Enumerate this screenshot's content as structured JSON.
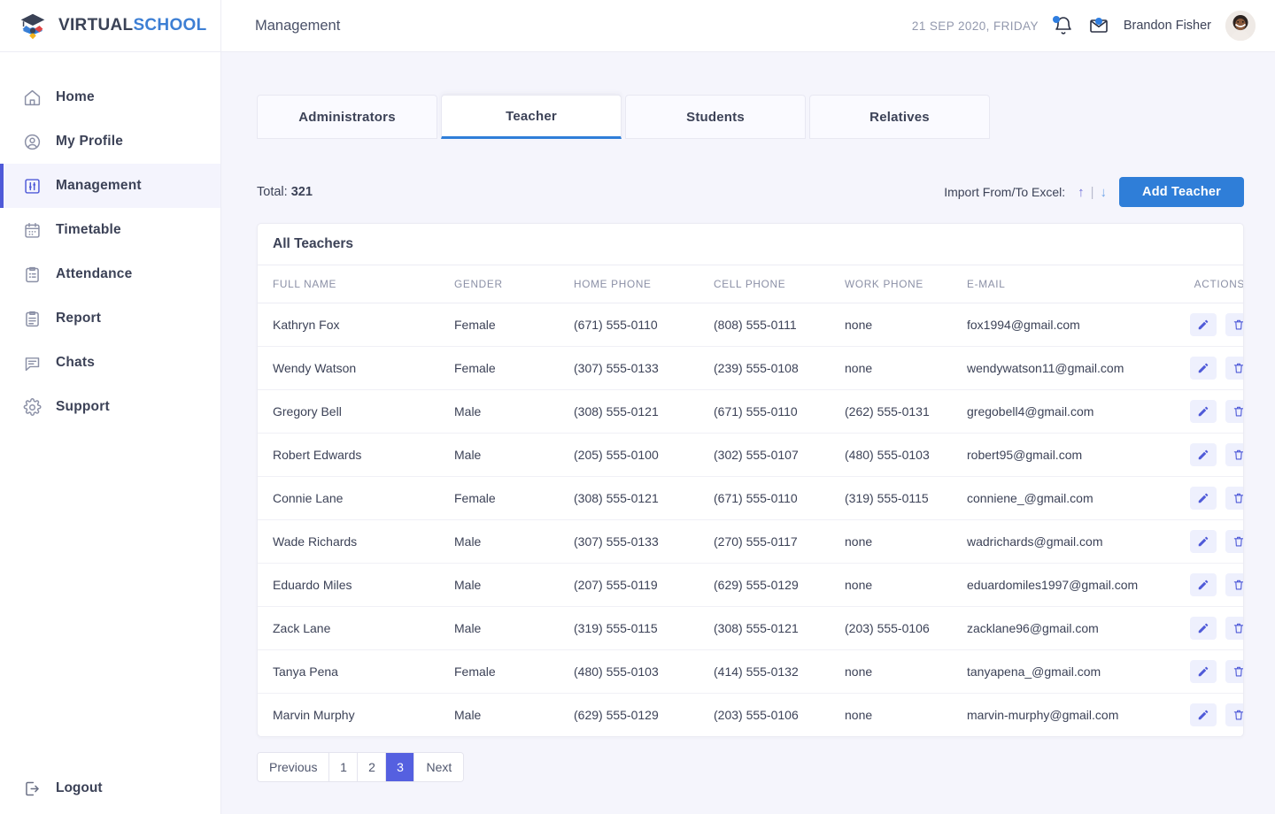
{
  "brand": {
    "name_dark": "VIRTUAL",
    "name_blue": "SCHOOL",
    "logo_icon": "graduation-cap-pinwheel-icon"
  },
  "sidebar": {
    "items": [
      {
        "label": "Home",
        "icon": "home-icon",
        "active": false
      },
      {
        "label": "My Profile",
        "icon": "user-circle-icon",
        "active": false
      },
      {
        "label": "Management",
        "icon": "sliders-icon",
        "active": true
      },
      {
        "label": "Timetable",
        "icon": "calendar-icon",
        "active": false
      },
      {
        "label": "Attendance",
        "icon": "clipboard-list-icon",
        "active": false
      },
      {
        "label": "Report",
        "icon": "clipboard-text-icon",
        "active": false
      },
      {
        "label": "Chats",
        "icon": "chat-bubble-icon",
        "active": false
      },
      {
        "label": "Support",
        "icon": "gear-icon",
        "active": false
      }
    ],
    "logout": {
      "label": "Logout",
      "icon": "logout-icon"
    }
  },
  "header": {
    "title": "Management",
    "date": "21 SEP 2020, FRIDAY",
    "bell_icon": "bell-icon",
    "mail_icon": "envelope-icon",
    "username": "Brandon Fisher",
    "avatar": "user-avatar"
  },
  "tabs": [
    {
      "label": "Administrators",
      "active": false
    },
    {
      "label": "Teacher",
      "active": true
    },
    {
      "label": "Students",
      "active": false
    },
    {
      "label": "Relatives",
      "active": false
    }
  ],
  "toolbar": {
    "total_label": "Total:",
    "total_value": "321",
    "import_label": "Import From/To Excel:",
    "arrow_up": "↑",
    "arrow_sep": "|",
    "arrow_down": "↓",
    "add_button": "Add Teacher"
  },
  "table": {
    "title": "All Teachers",
    "columns": [
      "FULL NAME",
      "GENDER",
      "HOME PHONE",
      "CELL PHONE",
      "WORK PHONE",
      "E-MAIL",
      "ACTIONS"
    ],
    "rows": [
      {
        "name": "Kathryn Fox",
        "gender": "Female",
        "home": "(671) 555-0110",
        "cell": "(808) 555-0111",
        "work": "none",
        "email": "fox1994@gmail.com"
      },
      {
        "name": "Wendy Watson",
        "gender": "Female",
        "home": "(307) 555-0133",
        "cell": "(239) 555-0108",
        "work": "none",
        "email": "wendywatson11@gmail.com"
      },
      {
        "name": "Gregory Bell",
        "gender": "Male",
        "home": "(308) 555-0121",
        "cell": "(671) 555-0110",
        "work": "(262) 555-0131",
        "email": "gregobell4@gmail.com"
      },
      {
        "name": "Robert Edwards",
        "gender": "Male",
        "home": "(205) 555-0100",
        "cell": "(302) 555-0107",
        "work": "(480) 555-0103",
        "email": "robert95@gmail.com"
      },
      {
        "name": "Connie Lane",
        "gender": "Female",
        "home": "(308) 555-0121",
        "cell": "(671) 555-0110",
        "work": "(319) 555-0115",
        "email": "conniene_@gmail.com"
      },
      {
        "name": "Wade Richards",
        "gender": "Male",
        "home": "(307) 555-0133",
        "cell": "(270) 555-0117",
        "work": "none",
        "email": "wadrichards@gmail.com"
      },
      {
        "name": "Eduardo Miles",
        "gender": "Male",
        "home": "(207) 555-0119",
        "cell": "(629) 555-0129",
        "work": "none",
        "email": "eduardomiles1997@gmail.com"
      },
      {
        "name": "Zack Lane",
        "gender": "Male",
        "home": "(319) 555-0115",
        "cell": "(308) 555-0121",
        "work": "(203) 555-0106",
        "email": "zacklane96@gmail.com"
      },
      {
        "name": "Tanya Pena",
        "gender": "Female",
        "home": "(480) 555-0103",
        "cell": "(414) 555-0132",
        "work": "none",
        "email": "tanyapena_@gmail.com"
      },
      {
        "name": "Marvin Murphy",
        "gender": "Male",
        "home": "(629) 555-0129",
        "cell": "(203) 555-0106",
        "work": "none",
        "email": "marvin-murphy@gmail.com"
      }
    ],
    "row_actions": {
      "edit_icon": "pencil-icon",
      "delete_icon": "trash-icon"
    }
  },
  "pagination": {
    "previous": "Previous",
    "pages": [
      "1",
      "2",
      "3"
    ],
    "active_page": "3",
    "next": "Next"
  },
  "colors": {
    "accent_blue": "#2f7ed8",
    "accent_indigo": "#4f5ad8",
    "page_bg": "#f5f5fc",
    "text_dark": "#3c4257",
    "text_muted": "#8b90a6"
  }
}
